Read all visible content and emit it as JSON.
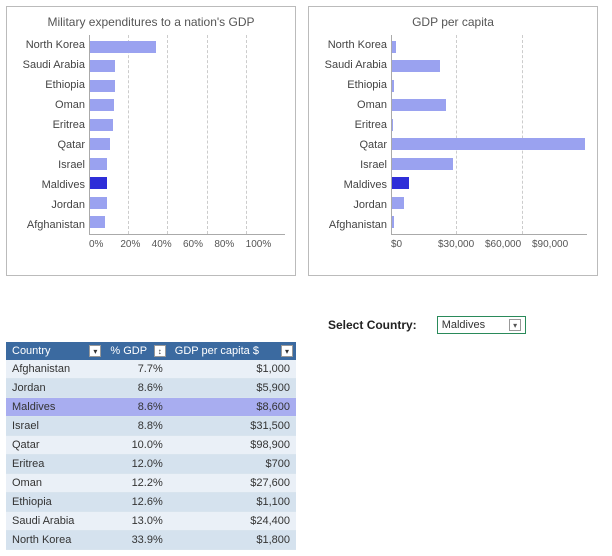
{
  "chart_data": [
    {
      "type": "bar",
      "orientation": "horizontal",
      "title": "Military expenditures to a nation's GDP",
      "categories": [
        "North Korea",
        "Saudi Arabia",
        "Ethiopia",
        "Oman",
        "Eritrea",
        "Qatar",
        "Israel",
        "Maldives",
        "Jordan",
        "Afghanistan"
      ],
      "values": [
        33.9,
        13.0,
        12.6,
        12.2,
        12.0,
        10.0,
        8.8,
        8.6,
        8.6,
        7.7
      ],
      "xlabel": "",
      "ylabel": "",
      "xlim": [
        0,
        100
      ],
      "ticks": [
        "0%",
        "20%",
        "40%",
        "60%",
        "80%",
        "100%"
      ],
      "highlight": "Maldives"
    },
    {
      "type": "bar",
      "orientation": "horizontal",
      "title": "GDP per capita",
      "categories": [
        "North Korea",
        "Saudi Arabia",
        "Ethiopia",
        "Oman",
        "Eritrea",
        "Qatar",
        "Israel",
        "Maldives",
        "Jordan",
        "Afghanistan"
      ],
      "values": [
        1800,
        24400,
        1100,
        27600,
        700,
        98900,
        31500,
        8600,
        5900,
        1000
      ],
      "xlabel": "",
      "ylabel": "",
      "xlim": [
        0,
        100000
      ],
      "ticks": [
        "$0",
        "$30,000",
        "$60,000",
        "$90,000"
      ],
      "highlight": "Maldives"
    }
  ],
  "table": {
    "headers": [
      "Country",
      "% GDP",
      "GDP per capita $"
    ],
    "rows": [
      {
        "country": "Afghanistan",
        "pct": "7.7%",
        "gdp": "$1,000"
      },
      {
        "country": "Jordan",
        "pct": "8.6%",
        "gdp": "$5,900"
      },
      {
        "country": "Maldives",
        "pct": "8.6%",
        "gdp": "$8,600",
        "highlight": true
      },
      {
        "country": "Israel",
        "pct": "8.8%",
        "gdp": "$31,500"
      },
      {
        "country": "Qatar",
        "pct": "10.0%",
        "gdp": "$98,900"
      },
      {
        "country": "Eritrea",
        "pct": "12.0%",
        "gdp": "$700"
      },
      {
        "country": "Oman",
        "pct": "12.2%",
        "gdp": "$27,600"
      },
      {
        "country": "Ethiopia",
        "pct": "12.6%",
        "gdp": "$1,100"
      },
      {
        "country": "Saudi Arabia",
        "pct": "13.0%",
        "gdp": "$24,400"
      },
      {
        "country": "North Korea",
        "pct": "33.9%",
        "gdp": "$1,800"
      }
    ]
  },
  "selector": {
    "label": "Select Country:",
    "value": "Maldives"
  },
  "icons": {
    "dropdown": "▾",
    "sort": "↕"
  }
}
